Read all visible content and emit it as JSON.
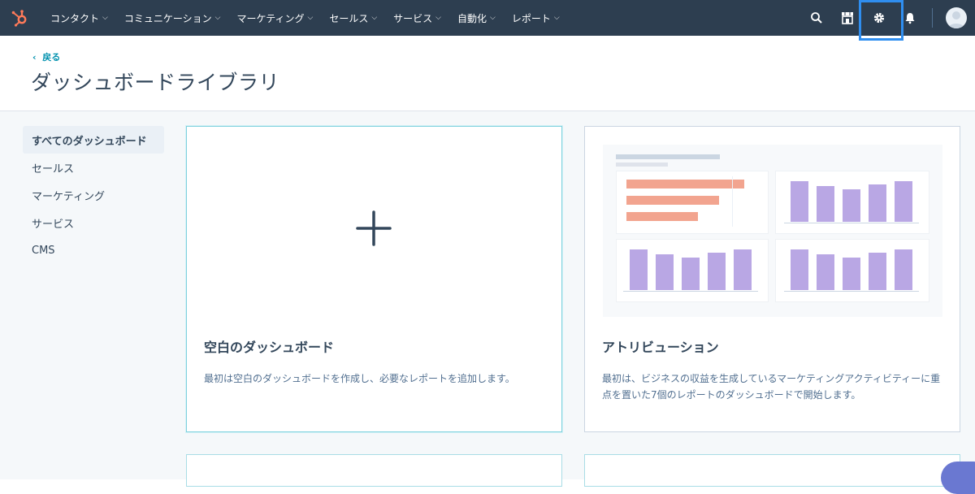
{
  "nav": {
    "items": [
      {
        "label": "コンタクト"
      },
      {
        "label": "コミュニケーション"
      },
      {
        "label": "マーケティング"
      },
      {
        "label": "セールス"
      },
      {
        "label": "サービス"
      },
      {
        "label": "自動化"
      },
      {
        "label": "レポート"
      }
    ],
    "icons": [
      "search-icon",
      "marketplace-icon",
      "settings-icon",
      "notifications-icon"
    ],
    "highlight_color": "#2f8ef0",
    "background_color": "#2d3e50"
  },
  "header": {
    "back_label": "戻る",
    "title": "ダッシュボードライブラリ"
  },
  "sidebar": {
    "items": [
      {
        "label": "すべてのダッシュボード",
        "active": true
      },
      {
        "label": "セールス"
      },
      {
        "label": "マーケティング"
      },
      {
        "label": "サービス"
      },
      {
        "label": "CMS"
      }
    ]
  },
  "cards": [
    {
      "title": "空白のダッシュボード",
      "description": "最初は空白のダッシュボードを作成し、必要なレポートを追加します。"
    },
    {
      "title": "アトリビューション",
      "description": "最初は、ビジネスの収益を生成しているマーケティングアクティビティーに重点を置いた7個のレポートのダッシュボードで開始します。"
    }
  ],
  "colors": {
    "accent_teal": "#0091ae",
    "bar_purple": "#b9a7e4",
    "bar_salmon": "#f2a48f"
  }
}
